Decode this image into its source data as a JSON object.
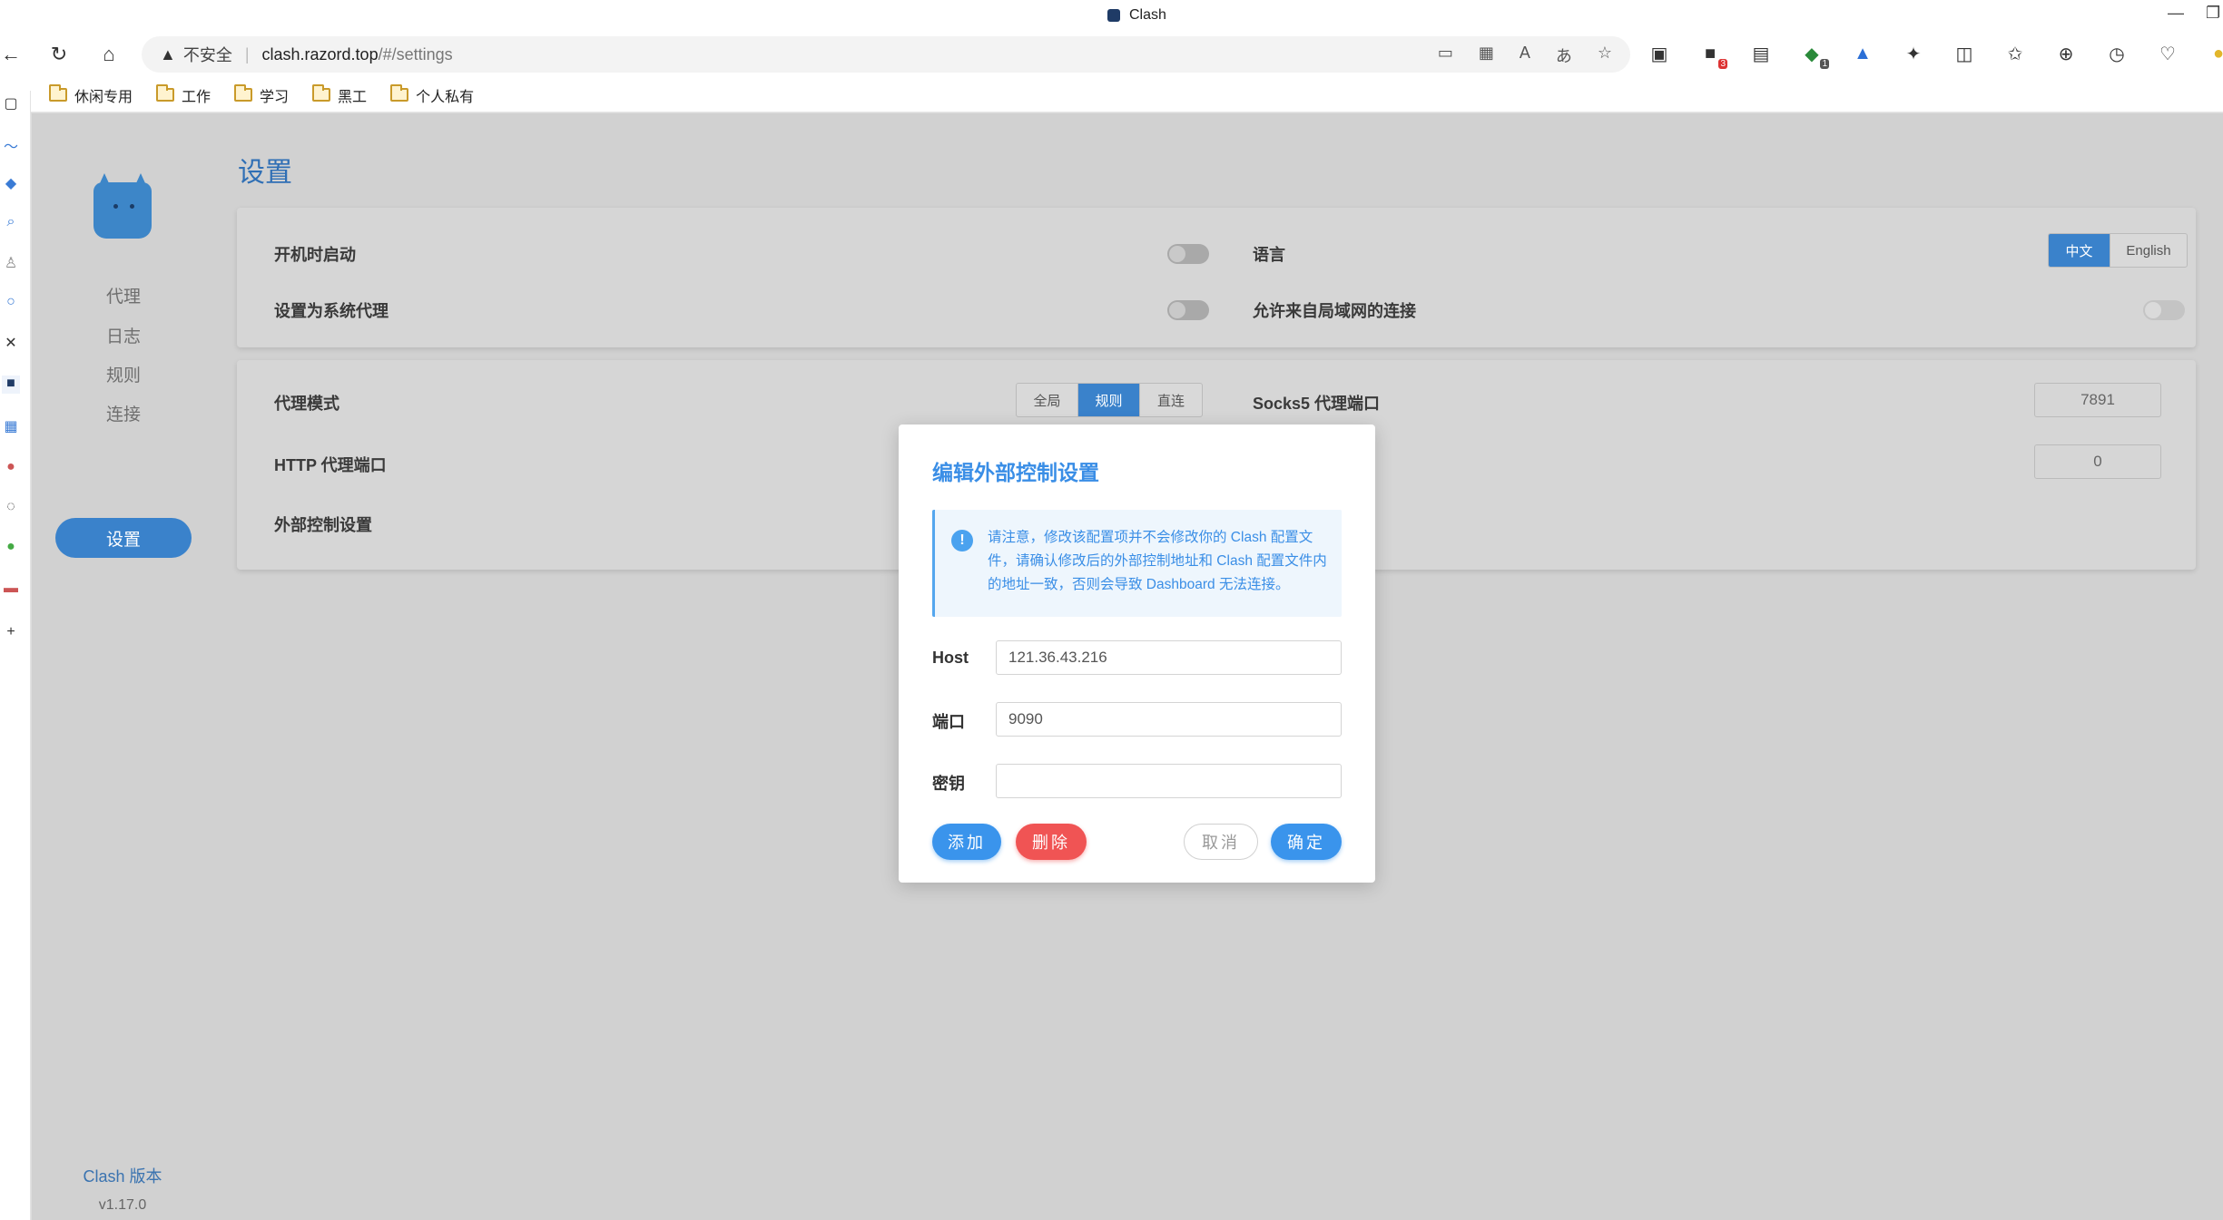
{
  "window": {
    "title": "Clash"
  },
  "browser": {
    "insecure_label": "不安全",
    "url_host": "clash.razord.top",
    "url_path": "/#/settings",
    "bookmarks": [
      "休闲专用",
      "工作",
      "学习",
      "黑工",
      "个人私有"
    ],
    "ext_badges": {
      "badge1": "3",
      "badge2": "1"
    }
  },
  "sidebar": {
    "items": [
      {
        "label": "代理"
      },
      {
        "label": "日志"
      },
      {
        "label": "规则"
      },
      {
        "label": "连接"
      },
      {
        "label": "设置",
        "active": true
      }
    ],
    "version_label": "Clash 版本",
    "version_value": "v1.17.0"
  },
  "page": {
    "title": "设置",
    "card1": {
      "startup_label": "开机时启动",
      "system_proxy_label": "设置为系统代理",
      "language_label": "语言",
      "language_options": [
        "中文",
        "English"
      ],
      "language_selected": "中文",
      "lan_label": "允许来自局域网的连接"
    },
    "card2": {
      "proxy_mode_label": "代理模式",
      "proxy_mode_options": [
        "全局",
        "规则",
        "直连"
      ],
      "proxy_mode_selected": "规则",
      "http_port_label": "HTTP 代理端口",
      "external_control_label": "外部控制设置",
      "socks5_label": "Socks5 代理端口",
      "socks5_port": "7891",
      "mixed_port": "0"
    }
  },
  "modal": {
    "title": "编辑外部控制设置",
    "alert": "请注意，修改该配置项并不会修改你的 Clash 配置文件，请确认修改后的外部控制地址和 Clash 配置文件内的地址一致，否则会导致 Dashboard 无法连接。",
    "host_label": "Host",
    "host_value": "121.36.43.216",
    "port_label": "端口",
    "port_value": "9090",
    "secret_label": "密钥",
    "secret_value": "",
    "add_label": "添加",
    "delete_label": "删除",
    "cancel_label": "取消",
    "confirm_label": "确定"
  },
  "colors": {
    "accent": "#3a82cb",
    "modal_accent": "#3a8ee6",
    "danger": "#f05454"
  }
}
